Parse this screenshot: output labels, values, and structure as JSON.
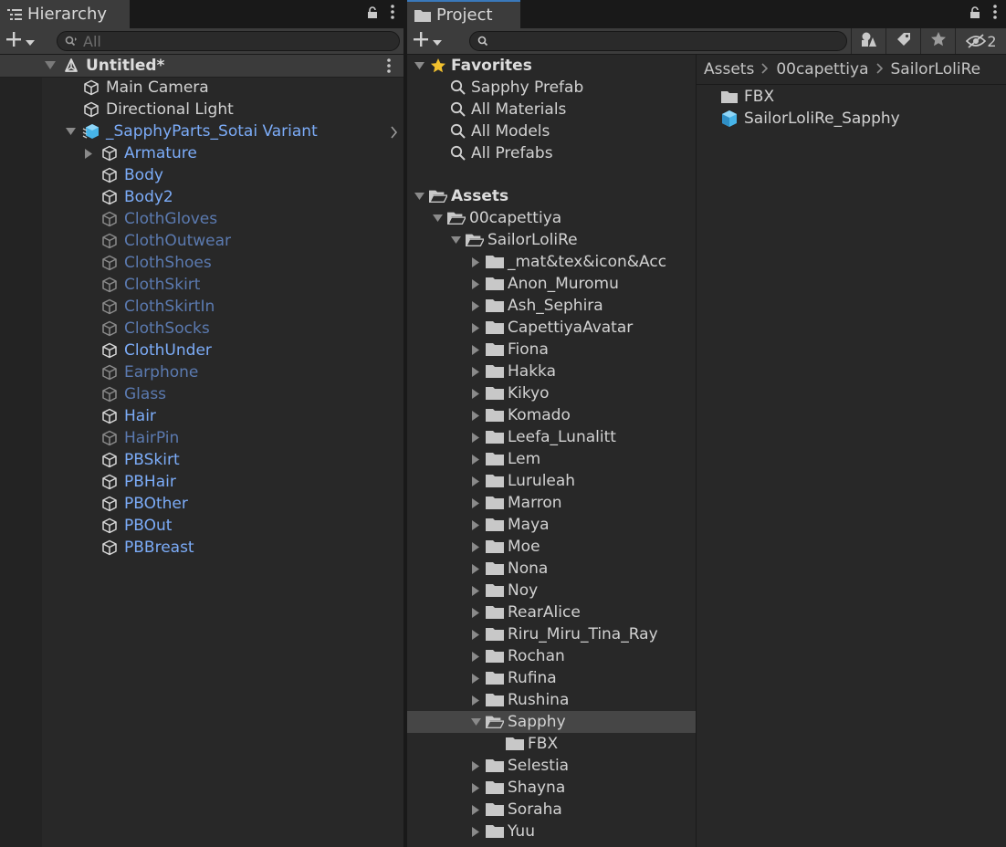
{
  "hierarchy": {
    "tab_label": "Hierarchy",
    "search_placeholder": "All",
    "scene_name": "Untitled*",
    "items": [
      {
        "label": "Main Camera",
        "style": "white",
        "arrow": false
      },
      {
        "label": "Directional Light",
        "style": "white",
        "arrow": false
      },
      {
        "label": "_SapphyParts_Sotai Variant",
        "style": "blue",
        "arrow": "down",
        "prefab": true
      },
      {
        "label": "Armature",
        "style": "blue",
        "arrow": "right"
      },
      {
        "label": "Body",
        "style": "blue"
      },
      {
        "label": "Body2",
        "style": "blue"
      },
      {
        "label": "ClothGloves",
        "style": "dim"
      },
      {
        "label": "ClothOutwear",
        "style": "dim"
      },
      {
        "label": "ClothShoes",
        "style": "dim"
      },
      {
        "label": "ClothSkirt",
        "style": "dim"
      },
      {
        "label": "ClothSkirtIn",
        "style": "dim"
      },
      {
        "label": "ClothSocks",
        "style": "dim"
      },
      {
        "label": "ClothUnder",
        "style": "blue"
      },
      {
        "label": "Earphone",
        "style": "dim"
      },
      {
        "label": "Glass",
        "style": "dim"
      },
      {
        "label": "Hair",
        "style": "blue"
      },
      {
        "label": "HairPin",
        "style": "dim"
      },
      {
        "label": "PBSkirt",
        "style": "blue"
      },
      {
        "label": "PBHair",
        "style": "blue"
      },
      {
        "label": "PBOther",
        "style": "blue"
      },
      {
        "label": "PBOut",
        "style": "blue"
      },
      {
        "label": "PBBreast",
        "style": "blue"
      }
    ]
  },
  "project": {
    "tab_label": "Project",
    "hidden_count": "2",
    "favorites": {
      "label": "Favorites",
      "items": [
        "Sapphy Prefab",
        "All Materials",
        "All Models",
        "All Prefabs"
      ]
    },
    "assets_label": "Assets",
    "capettiya_label": "00capettiya",
    "sailor_label": "SailorLoliRe",
    "folders": [
      "_mat&tex&icon&Acc",
      "Anon_Muromu",
      "Ash_Sephira",
      "CapettiyaAvatar",
      "Fiona",
      "Hakka",
      "Kikyo",
      "Komado",
      "Leefa_Lunalitt",
      "Lem",
      "Luruleah",
      "Marron",
      "Maya",
      "Moe",
      "Nona",
      "Noy",
      "RearAlice",
      "Riru_Miru_Tina_Ray",
      "Rochan",
      "Rufina",
      "Rushina",
      "Sapphy",
      "Selestia",
      "Shayna",
      "Soraha",
      "Yuu"
    ],
    "selected_folder": "Sapphy",
    "sapphy_child": "FBX",
    "breadcrumb": [
      "Assets",
      "00capettiya",
      "SailorLoliRe"
    ],
    "contents": [
      {
        "label": "FBX",
        "icon": "folder-icon"
      },
      {
        "label": "SailorLoliRe_Sapphy",
        "icon": "prefab-icon"
      }
    ]
  },
  "colors": {
    "accent": "#3a79bb",
    "prefab_blue": "#7cacf8",
    "inactive_blue": "#5b7ab0",
    "panel": "#282828"
  }
}
